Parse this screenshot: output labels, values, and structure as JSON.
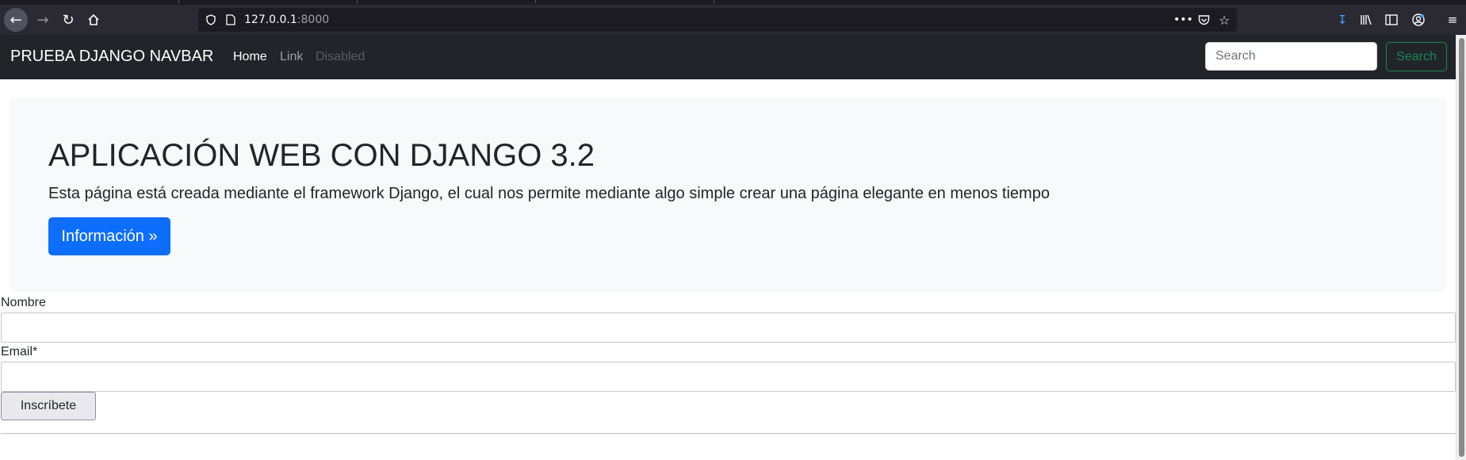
{
  "browser": {
    "url_host": "127.0.0.1",
    "url_port": ":8000",
    "icons": {
      "back": "arrow-left-icon",
      "forward": "arrow-right-icon",
      "reload": "reload-icon",
      "home": "home-icon",
      "tracking": "shield-icon",
      "page": "page-icon",
      "more": "ellipsis-icon",
      "pocket": "pocket-icon",
      "bookmark": "star-icon",
      "downloads": "download-icon",
      "library": "library-icon",
      "sidebar": "sidebar-icon",
      "account": "account-icon",
      "menu": "hamburger-menu-icon"
    }
  },
  "navbar": {
    "brand": "PRUEBA DJANGO NAVBAR",
    "links": {
      "home": "Home",
      "link": "Link",
      "disabled": "Disabled"
    },
    "search_placeholder": "Search",
    "search_button": "Search"
  },
  "jumbotron": {
    "title": "APLICACIÓN WEB CON DJANGO 3.2",
    "lead": "Esta página está creada mediante el framework Django, el cual nos permite mediante algo simple crear una página elegante en menos tiempo",
    "button": "Información »"
  },
  "form": {
    "nombre_label": "Nombre",
    "nombre_value": "",
    "email_label": "Email*",
    "email_value": "",
    "submit": "Inscríbete"
  },
  "colors": {
    "navbar_bg": "#212529",
    "primary": "#0d6efd",
    "success": "#198754",
    "jumbotron_bg": "#f8f9fa"
  }
}
